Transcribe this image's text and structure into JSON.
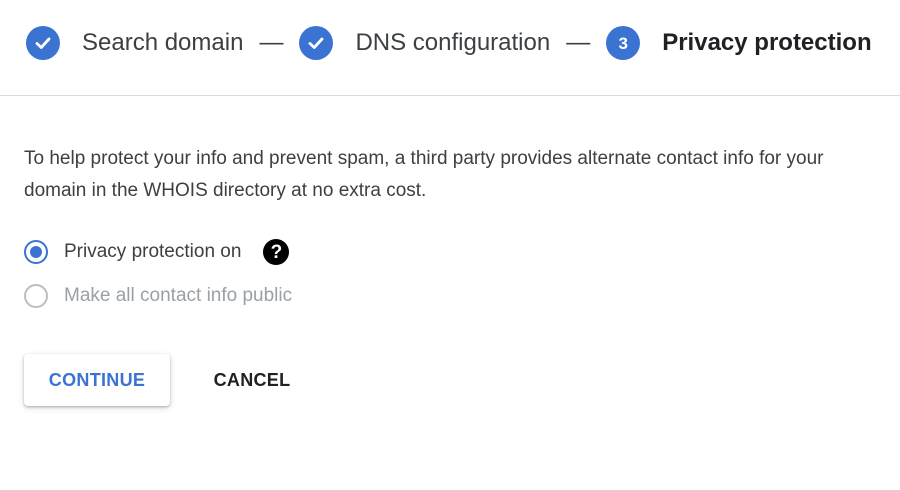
{
  "stepper": {
    "steps": [
      {
        "label": "Search domain",
        "status": "completed",
        "icon": "check-icon"
      },
      {
        "label": "DNS configuration",
        "status": "completed",
        "icon": "check-icon"
      },
      {
        "label": "Privacy protection",
        "status": "active",
        "number": "3"
      }
    ],
    "separator": "—"
  },
  "main": {
    "description": "To help protect your info and prevent spam, a third party provides alternate contact info for your domain in the WHOIS directory at no extra cost.",
    "options": [
      {
        "label": "Privacy protection on",
        "selected": true,
        "disabled": false,
        "help_icon": "question-mark-circle-icon"
      },
      {
        "label": "Make all contact info public",
        "selected": false,
        "disabled": true
      }
    ],
    "help_icon_glyph": "?"
  },
  "actions": {
    "continue_label": "CONTINUE",
    "cancel_label": "CANCEL"
  },
  "colors": {
    "accent": "#3b73d3",
    "divider": "#dadce0",
    "disabled": "#bdbdbd"
  }
}
